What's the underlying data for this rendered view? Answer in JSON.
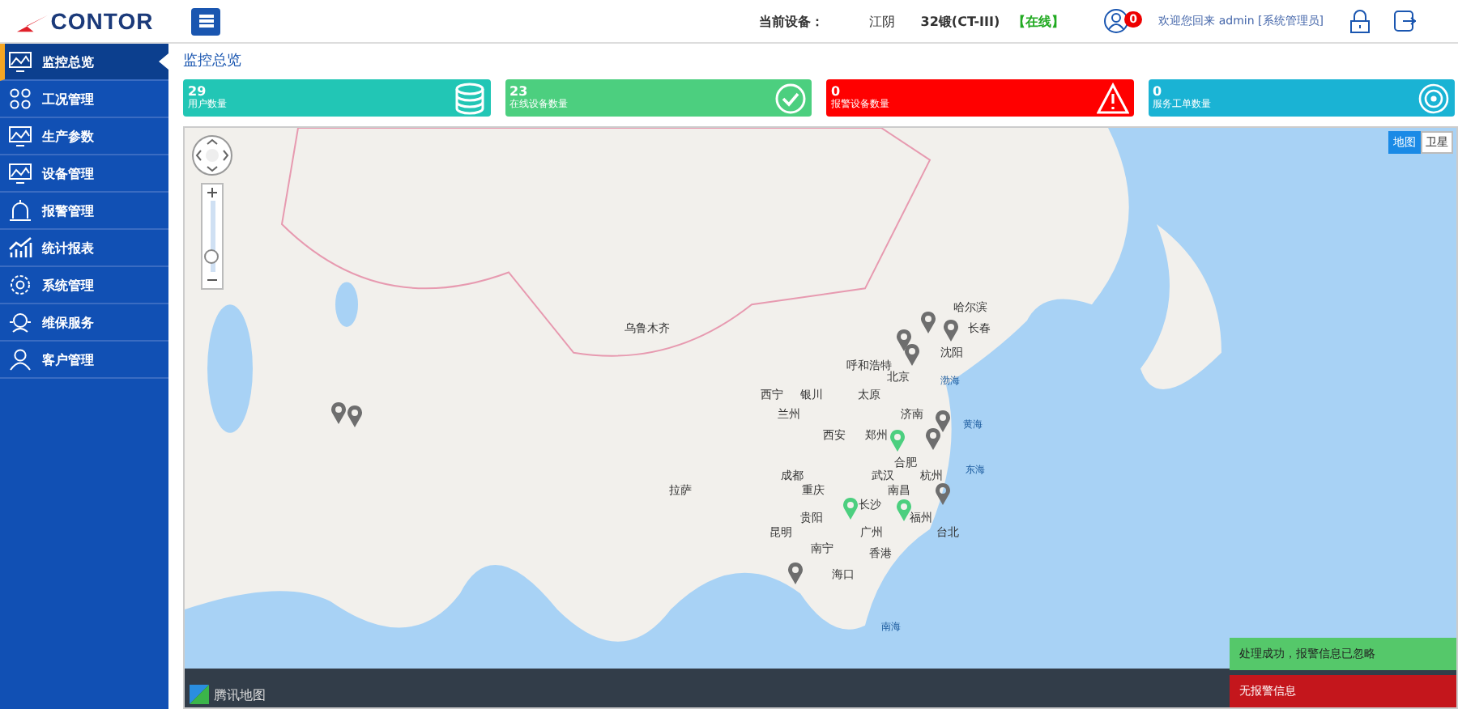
{
  "header": {
    "logo": "CONTOR",
    "device_label": "当前设备：",
    "device_location": "江阴",
    "device_model": "32锻(CT-III)",
    "device_status": "【在线】",
    "notification_count": "0",
    "welcome": "欢迎您回来 admin [系统管理员]"
  },
  "sidebar": {
    "items": [
      {
        "label": "监控总览",
        "selected": true
      },
      {
        "label": "工况管理",
        "selected": false
      },
      {
        "label": "生产参数",
        "selected": false
      },
      {
        "label": "设备管理",
        "selected": false
      },
      {
        "label": "报警管理",
        "selected": false
      },
      {
        "label": "统计报表",
        "selected": false
      },
      {
        "label": "系统管理",
        "selected": false
      },
      {
        "label": "维保服务",
        "selected": false
      },
      {
        "label": "客户管理",
        "selected": false
      }
    ]
  },
  "page_title": "监控总览",
  "stats": [
    {
      "value": "29",
      "label": "用户数量",
      "color": "#22c6b5"
    },
    {
      "value": "23",
      "label": "在线设备数量",
      "color": "#4ccf7f"
    },
    {
      "value": "0",
      "label": "报警设备数量",
      "color": "#ff0000"
    },
    {
      "value": "0",
      "label": "服务工单数量",
      "color": "#1ab3d4"
    }
  ],
  "map": {
    "map_types": [
      {
        "label": "地图",
        "selected": true
      },
      {
        "label": "卫星",
        "selected": false
      }
    ],
    "zoom": {
      "level": 0.2
    },
    "cities": [
      "哈尔滨",
      "乌鲁木齐",
      "长春",
      "沈阳",
      "呼和浩特",
      "北京",
      "西宁",
      "银川",
      "太原",
      "兰州",
      "济南",
      "西安",
      "郑州",
      "合肥",
      "成都",
      "武汉",
      "杭州",
      "拉萨",
      "重庆",
      "南昌",
      "长沙",
      "贵阳",
      "福州",
      "昆明",
      "广州",
      "台北",
      "南宁",
      "香港",
      "海口"
    ],
    "seas": [
      "渤海",
      "黄海",
      "东海",
      "南海"
    ],
    "pins": [
      {
        "color": "#6e6e6e"
      },
      {
        "color": "#6e6e6e"
      },
      {
        "color": "#6e6e6e"
      },
      {
        "color": "#6e6e6e"
      },
      {
        "color": "#6e6e6e"
      },
      {
        "color": "#6e6e6e"
      },
      {
        "color": "#6e6e6e"
      },
      {
        "color": "#6e6e6e"
      },
      {
        "color": "#6e6e6e"
      },
      {
        "color": "#6e6e6e"
      },
      {
        "color": "#4ccf7f"
      },
      {
        "color": "#4ccf7f"
      },
      {
        "color": "#4ccf7f"
      }
    ],
    "provider": "腾讯地图"
  },
  "toasts": [
    {
      "text": "处理成功，报警信息已忽略",
      "color": "#55c86a"
    },
    {
      "text": "无报警信息",
      "color": "#c4161c"
    }
  ]
}
